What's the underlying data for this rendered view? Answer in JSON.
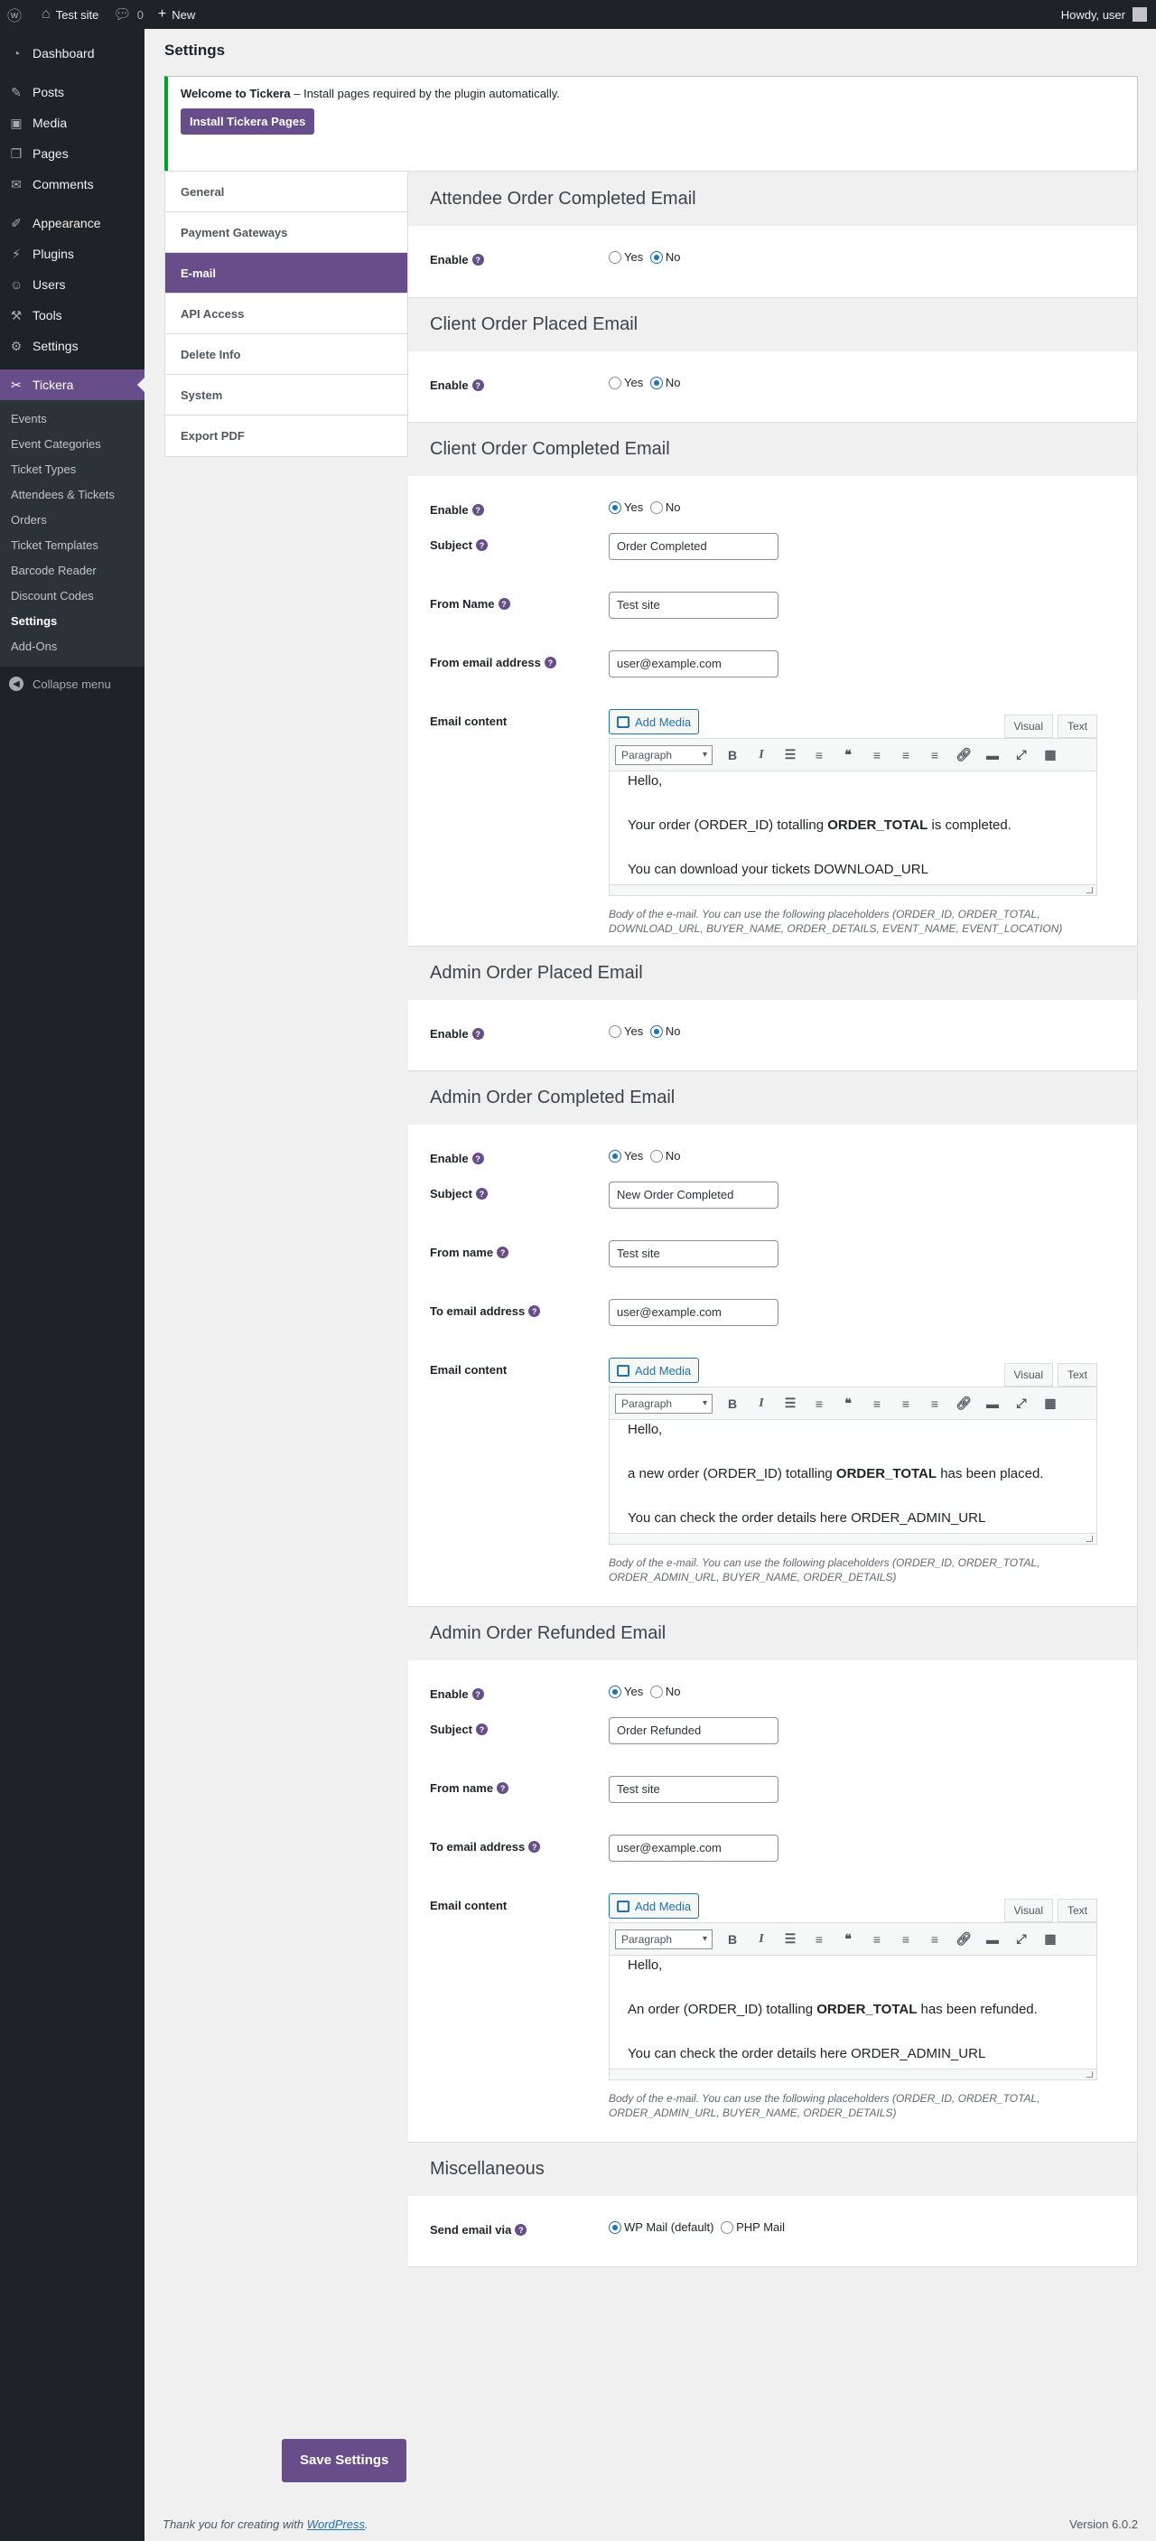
{
  "adminbar": {
    "site_name": "Test site",
    "comments_count": "0",
    "new_label": "New",
    "howdy": "Howdy, user"
  },
  "sidebar": {
    "items": [
      {
        "label": "Dashboard",
        "icon": "dashboard-icon"
      },
      {
        "label": "Posts",
        "icon": "pin-icon"
      },
      {
        "label": "Media",
        "icon": "media-icon"
      },
      {
        "label": "Pages",
        "icon": "pages-icon"
      },
      {
        "label": "Comments",
        "icon": "comments-icon"
      },
      {
        "label": "Appearance",
        "icon": "brush-icon"
      },
      {
        "label": "Plugins",
        "icon": "plugin-icon"
      },
      {
        "label": "Users",
        "icon": "users-icon"
      },
      {
        "label": "Tools",
        "icon": "wrench-icon"
      },
      {
        "label": "Settings",
        "icon": "settings-icon"
      },
      {
        "label": "Tickera",
        "icon": "ticket-icon"
      }
    ],
    "tickera_sub": [
      "Events",
      "Event Categories",
      "Ticket Types",
      "Attendees & Tickets",
      "Orders",
      "Ticket Templates",
      "Barcode Reader",
      "Discount Codes",
      "Settings",
      "Add-Ons"
    ],
    "collapse": "Collapse menu"
  },
  "page": {
    "title": "Settings",
    "notice_bold": "Welcome to Tickera",
    "notice_text": " – Install pages required by the plugin automatically.",
    "install_button": "Install Tickera Pages"
  },
  "tabs": [
    "General",
    "Payment Gateways",
    "E-mail",
    "API Access",
    "Delete Info",
    "System",
    "Export PDF"
  ],
  "labels": {
    "enable": "Enable",
    "yes": "Yes",
    "no": "No",
    "subject": "Subject",
    "from_name_cap": "From Name",
    "from_name": "From name",
    "from_email": "From email address",
    "to_email": "To email address",
    "email_content": "Email content",
    "add_media": "Add Media",
    "visual": "Visual",
    "text": "Text",
    "paragraph": "Paragraph",
    "help": "?"
  },
  "sections": {
    "attendee_completed": {
      "title": "Attendee Order Completed Email",
      "enabled": false
    },
    "client_placed": {
      "title": "Client Order Placed Email",
      "enabled": false
    },
    "client_completed": {
      "title": "Client Order Completed Email",
      "enabled": true,
      "subject": "Order Completed",
      "from_name": "Test site",
      "from_email": "user@example.com",
      "body_hello": "Hello,",
      "body_l2a": "Your order (ORDER_ID) totalling ",
      "body_l2b": "ORDER_TOTAL",
      "body_l2c": " is completed.",
      "body_l3": "You can download your tickets DOWNLOAD_URL",
      "desc": "Body of the e-mail. You can use the following placeholders (ORDER_ID, ORDER_TOTAL, DOWNLOAD_URL, BUYER_NAME, ORDER_DETAILS, EVENT_NAME, EVENT_LOCATION)"
    },
    "admin_placed": {
      "title": "Admin Order Placed Email",
      "enabled": false
    },
    "admin_completed": {
      "title": "Admin Order Completed Email",
      "enabled": true,
      "subject": "New Order Completed",
      "from_name": "Test site",
      "to_email": "user@example.com",
      "body_hello": "Hello,",
      "body_l2a": "a new order (ORDER_ID) totalling ",
      "body_l2b": "ORDER_TOTAL",
      "body_l2c": " has been placed.",
      "body_l3": "You can check the order details here ORDER_ADMIN_URL",
      "desc": "Body of the e-mail. You can use the following placeholders (ORDER_ID, ORDER_TOTAL, ORDER_ADMIN_URL, BUYER_NAME, ORDER_DETAILS)"
    },
    "admin_refunded": {
      "title": "Admin Order Refunded Email",
      "enabled": true,
      "subject": "Order Refunded",
      "from_name": "Test site",
      "to_email": "user@example.com",
      "body_hello": "Hello,",
      "body_l2a": "An order (ORDER_ID) totalling ",
      "body_l2b": "ORDER_TOTAL",
      "body_l2c": " has been refunded.",
      "body_l3": "You can check the order details here ORDER_ADMIN_URL",
      "desc": "Body of the e-mail. You can use the following placeholders (ORDER_ID, ORDER_TOTAL, ORDER_ADMIN_URL, BUYER_NAME, ORDER_DETAILS)"
    },
    "misc": {
      "title": "Miscellaneous",
      "send_via_label": "Send email via",
      "opt_wp": "WP Mail (default)",
      "opt_php": "PHP Mail"
    }
  },
  "save_button": "Save Settings",
  "footer": {
    "text": "Thank you for creating with ",
    "link": "WordPress",
    "end": ".",
    "version": "Version 6.0.2"
  },
  "colors": {
    "accent": "#674e8a",
    "sidebar_bg": "#1d2327",
    "notice_border": "#00a32a",
    "link": "#2271b1"
  }
}
